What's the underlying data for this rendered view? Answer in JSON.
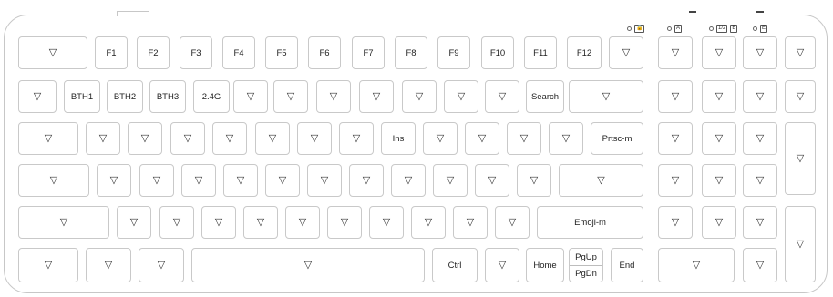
{
  "keys": {
    "esc": "▽",
    "f1": "F1",
    "f2": "F2",
    "f3": "F3",
    "f4": "F4",
    "f5": "F5",
    "f6": "F6",
    "f7": "F7",
    "f8": "F8",
    "f9": "F9",
    "f10": "F10",
    "f11": "F11",
    "f12": "F12",
    "bth1": "BTH1",
    "bth2": "BTH2",
    "bth3": "BTH3",
    "g24": "2.4G",
    "search": "Search",
    "ins": "Ins",
    "prtsc": "Prtsc-m",
    "emoji": "Emoji-m",
    "ctrl": "Ctrl",
    "home": "Home",
    "pgup": "PgUp",
    "pgdn": "PgDn",
    "end": "End",
    "blank": "▽"
  },
  "indicators": [
    {
      "glyph": "🔒"
    },
    {
      "glyph": "A"
    },
    {
      "glyph": "1/2",
      "glyph2": "B"
    },
    {
      "glyph": "E"
    }
  ]
}
